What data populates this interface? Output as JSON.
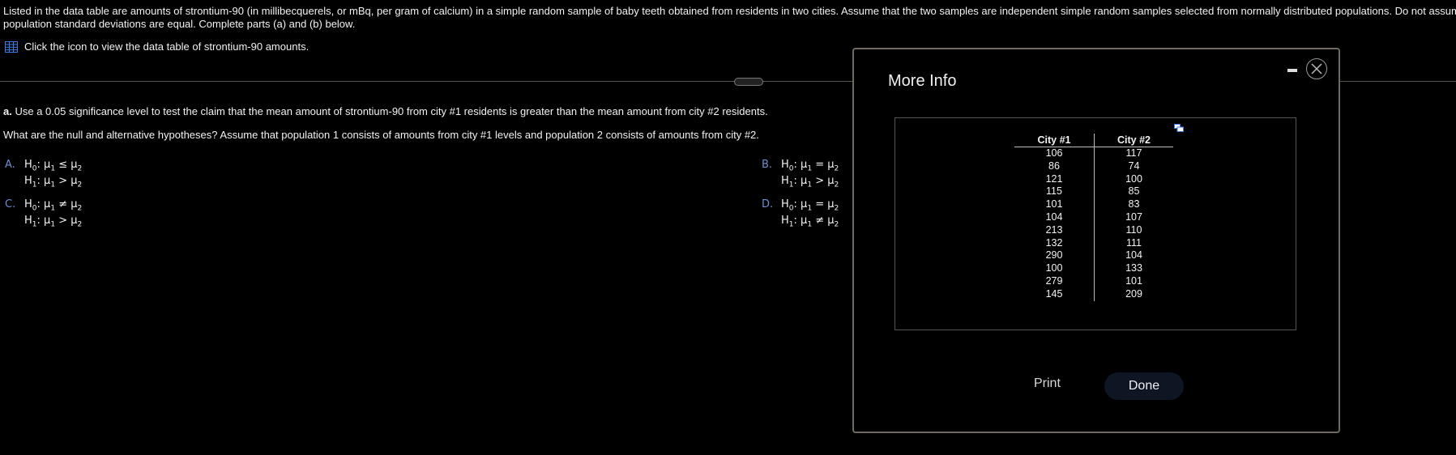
{
  "intro": {
    "line1": "Listed in the data table are amounts of strontium-90 (in millibecquerels, or mBq, per gram of calcium) in a simple random sample of baby teeth obtained from residents in two cities. Assume that the two samples are independent simple random samples selected from normally distributed populations. Do not assum",
    "line2": "population standard deviations are equal. Complete parts (a) and (b) below."
  },
  "datalink": {
    "icon": "table-icon",
    "text": "Click the icon to view the data table of strontium-90 amounts."
  },
  "question_a": {
    "label": "a.",
    "text": "Use a 0.05 significance level to test the claim that the mean amount of strontium-90 from city #1 residents is greater than the mean amount from city #2 residents.",
    "hypothesis_prompt": "What are the null and alternative hypotheses? Assume that population 1 consists of amounts from city #1 levels and population 2 consists of amounts from city #2."
  },
  "options": [
    {
      "letter": "A.",
      "h0": "≤",
      "h1": ">"
    },
    {
      "letter": "B.",
      "h0": "=",
      "h1": ">"
    },
    {
      "letter": "C.",
      "h0": "≠",
      "h1": ">"
    },
    {
      "letter": "D.",
      "h0": "=",
      "h1": "≠"
    }
  ],
  "modal": {
    "title": "More Info",
    "columns": [
      "City #1",
      "City #2"
    ],
    "rows": [
      [
        "106",
        "117"
      ],
      [
        "86",
        "74"
      ],
      [
        "121",
        "100"
      ],
      [
        "115",
        "85"
      ],
      [
        "101",
        "83"
      ],
      [
        "104",
        "107"
      ],
      [
        "213",
        "110"
      ],
      [
        "132",
        "111"
      ],
      [
        "290",
        "104"
      ],
      [
        "100",
        "133"
      ],
      [
        "279",
        "101"
      ],
      [
        "145",
        "209"
      ]
    ],
    "print_label": "Print",
    "done_label": "Done",
    "minimize_icon": "minimize-icon",
    "close_icon": "close-icon",
    "copy_icon": "copy-icon"
  }
}
